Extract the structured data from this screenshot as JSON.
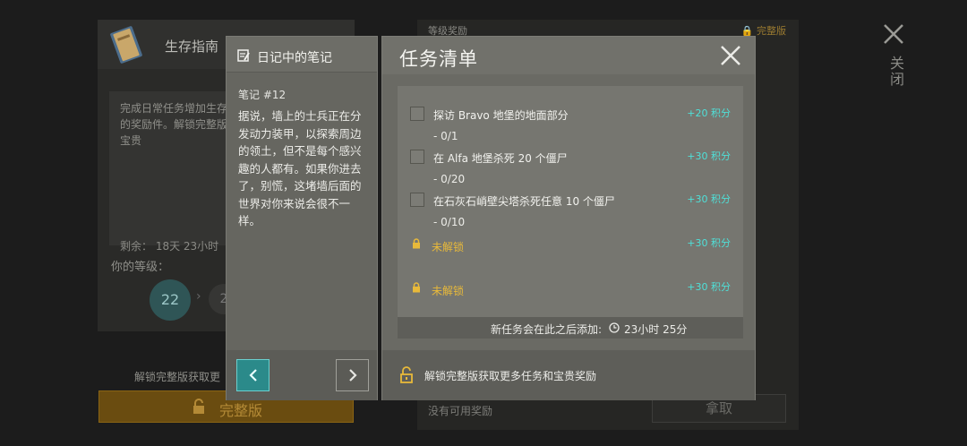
{
  "background": {
    "guide_title": "生存指南",
    "description": "完成日常任务增加生存值，任务，获取大量的奖励件。解锁完整版的日故事，获得更多宝贵",
    "remaining": "剩余：  18天 23小时",
    "level_label": "你的等级：",
    "level_current": "22",
    "level_next": "2",
    "unlock_text": "解锁完整版获取更",
    "full_button": "完整版",
    "level_rewards_label": "等级奖励",
    "full_version_tag": "完整版",
    "no_rewards": "没有可用奖励",
    "claim_button": "拿取",
    "close_label": "关闭"
  },
  "notes_panel": {
    "title": "日记中的笔记",
    "note_number": "笔记 #12",
    "note_text": "据说，墙上的士兵正在分发动力装甲，以探索周边的领土，但不是每个感兴趣的人都有。如果你进去了，别慌，这堵墙后面的世界对你来说会很不一样。"
  },
  "task_panel": {
    "title": "任务清单",
    "tasks": [
      {
        "name": "探访 Bravo 地堡的地面部分",
        "progress": "- 0/1",
        "points": "+20  积分"
      },
      {
        "name": "在 Alfa 地堡杀死 20 个僵尸",
        "progress": "- 0/20",
        "points": "+30  积分"
      },
      {
        "name": "在石灰石峭壁尖塔杀死任意 10 个僵尸",
        "progress": "- 0/10",
        "points": "+30  积分"
      }
    ],
    "locked": [
      {
        "label": "未解锁",
        "points": "+30  积分"
      },
      {
        "label": "未解锁",
        "points": "+30  积分"
      }
    ],
    "new_tasks_label": "新任务会在此之后添加:",
    "new_tasks_time": "23小时 25分",
    "footer_text": "解锁完整版获取更多任务和宝贵奖励"
  }
}
